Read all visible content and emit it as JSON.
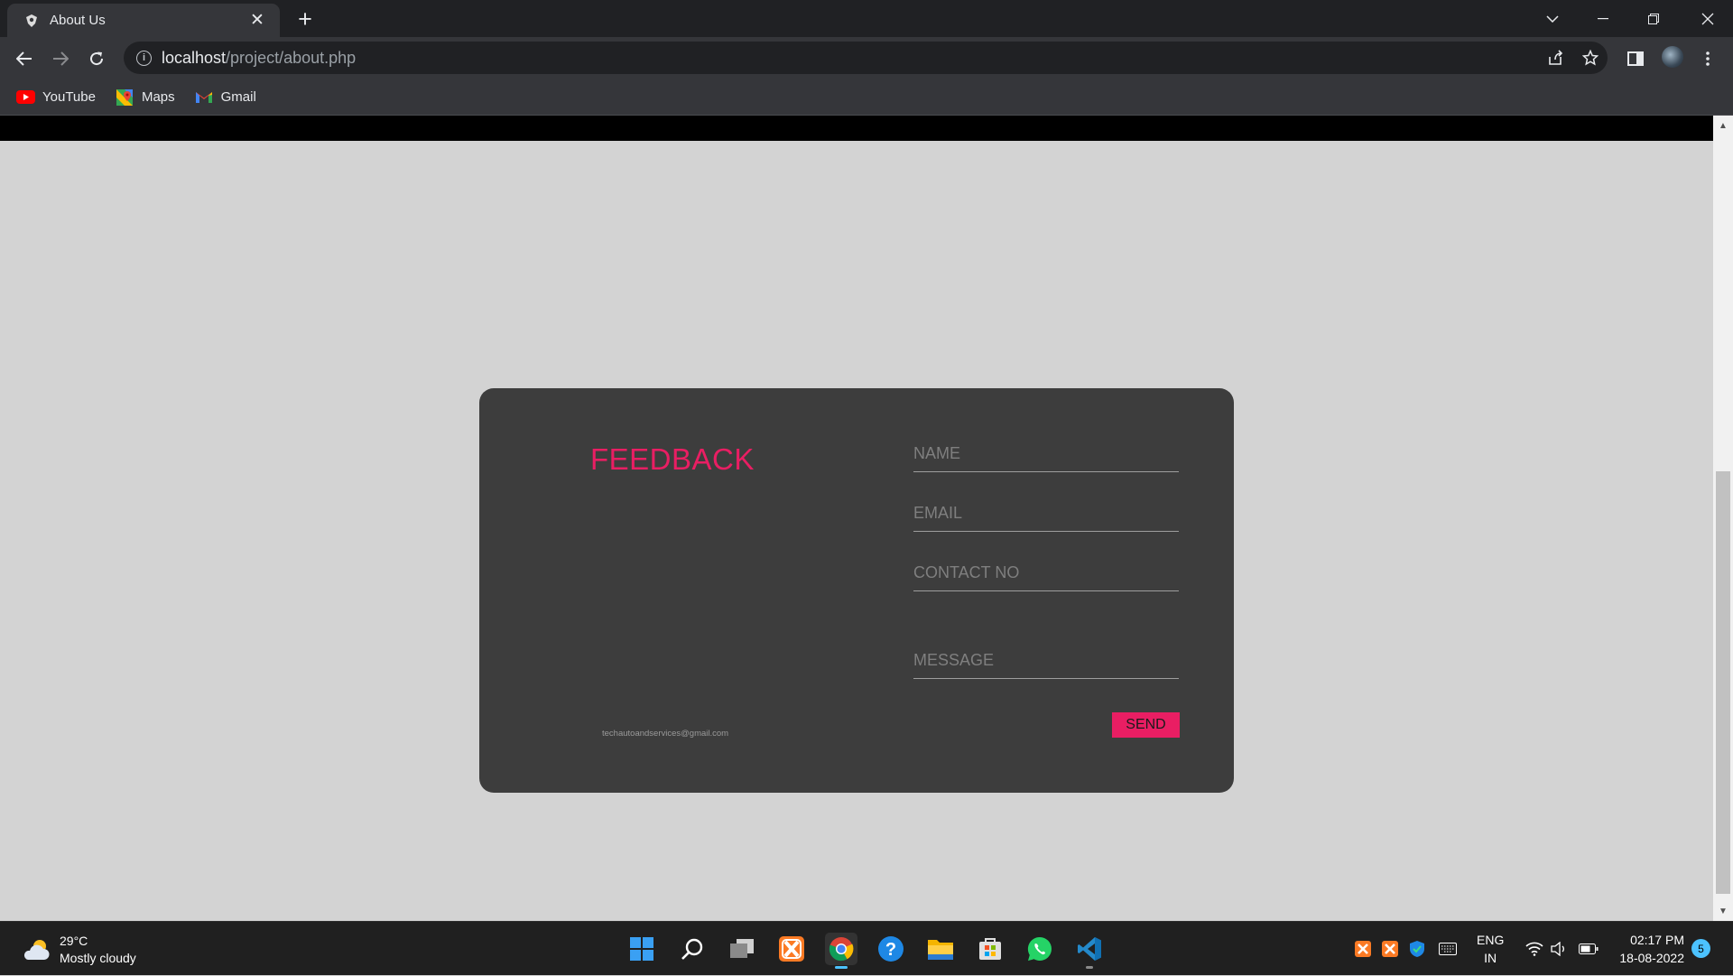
{
  "browser": {
    "tab_title": "About Us",
    "url_host": "localhost",
    "url_path": "/project/about.php",
    "bookmarks": [
      {
        "label": "YouTube",
        "icon": "youtube-icon"
      },
      {
        "label": "Maps",
        "icon": "maps-icon"
      },
      {
        "label": "Gmail",
        "icon": "gmail-icon"
      }
    ]
  },
  "feedback": {
    "title": "FEEDBACK",
    "contact_email": "techautoandservices@gmail.com",
    "name_placeholder": "NAME",
    "email_placeholder": "EMAIL",
    "contact_placeholder": "CONTACT NO",
    "message_placeholder": "MESSAGE",
    "send_label": "SEND"
  },
  "taskbar": {
    "weather_temp": "29°C",
    "weather_desc": "Mostly cloudy",
    "lang_line1": "ENG",
    "lang_line2": "IN",
    "time": "02:17 PM",
    "date": "18-08-2022",
    "notification_count": "5"
  },
  "colors": {
    "accent": "#e91e63",
    "card": "#3d3d3d",
    "page_bg": "#d3d3d3"
  }
}
